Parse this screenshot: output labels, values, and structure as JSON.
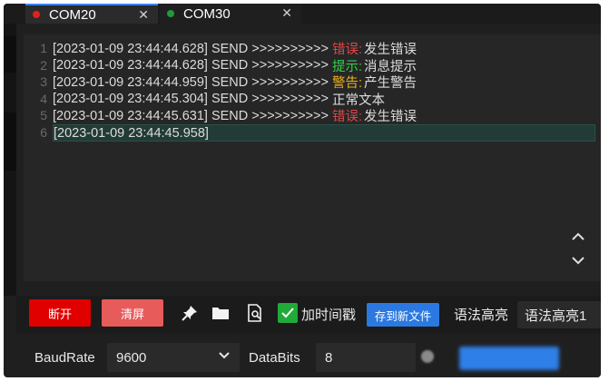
{
  "tabs": [
    {
      "label": "COM20",
      "dot_color": "#e02020",
      "active": true
    },
    {
      "label": "COM30",
      "dot_color": "#1f9a3a",
      "active": false
    }
  ],
  "tab_close_glyph": "✕",
  "editor": {
    "lines": [
      {
        "n": "1",
        "text": "[2023-01-09 23:44:44.628] SEND >>>>>>>>>>",
        "level": "错误:",
        "level_color": "#e04646",
        "msg": "发生错误"
      },
      {
        "n": "2",
        "text": "[2023-01-09 23:44:44.628] SEND >>>>>>>>>>",
        "level": "提示:",
        "level_color": "#2fd14a",
        "msg": "消息提示"
      },
      {
        "n": "3",
        "text": "[2023-01-09 23:44:44.959] SEND >>>>>>>>>>",
        "level": "警告:",
        "level_color": "#e8b01c",
        "msg": "产生警告"
      },
      {
        "n": "4",
        "text": "[2023-01-09 23:44:45.304] SEND >>>>>>>>>>",
        "level": "",
        "level_color": "#dcdcdc",
        "msg": "正常文本"
      },
      {
        "n": "5",
        "text": "[2023-01-09 23:44:45.631] SEND >>>>>>>>>>",
        "level": "错误:",
        "level_color": "#e04646",
        "msg": "发生错误"
      },
      {
        "n": "6",
        "text": "[2023-01-09 23:44:45.958]",
        "level": "",
        "level_color": "#dcdcdc",
        "msg": ""
      }
    ]
  },
  "toolbar": {
    "disconnect_label": "断开",
    "clear_label": "清屏",
    "pin_icon": "pin-icon",
    "folder_icon": "folder-icon",
    "search_file_icon": "file-search-icon",
    "timestamp_label": "加时间戳",
    "timestamp_checked": true,
    "save_new_file_label": "存到新文件",
    "highlight_label": "语法高亮",
    "highlight_value": "语法高亮1"
  },
  "bottom": {
    "baud_label": "BaudRate",
    "baud_value": "9600",
    "databits_label": "DataBits",
    "databits_value": "8"
  },
  "colors": {
    "accent": "#3b82f6",
    "disconnect": "#e00000",
    "clear": "#e85b5b",
    "save_btn": "#2b79e0",
    "checkbox": "#1faa3a"
  }
}
